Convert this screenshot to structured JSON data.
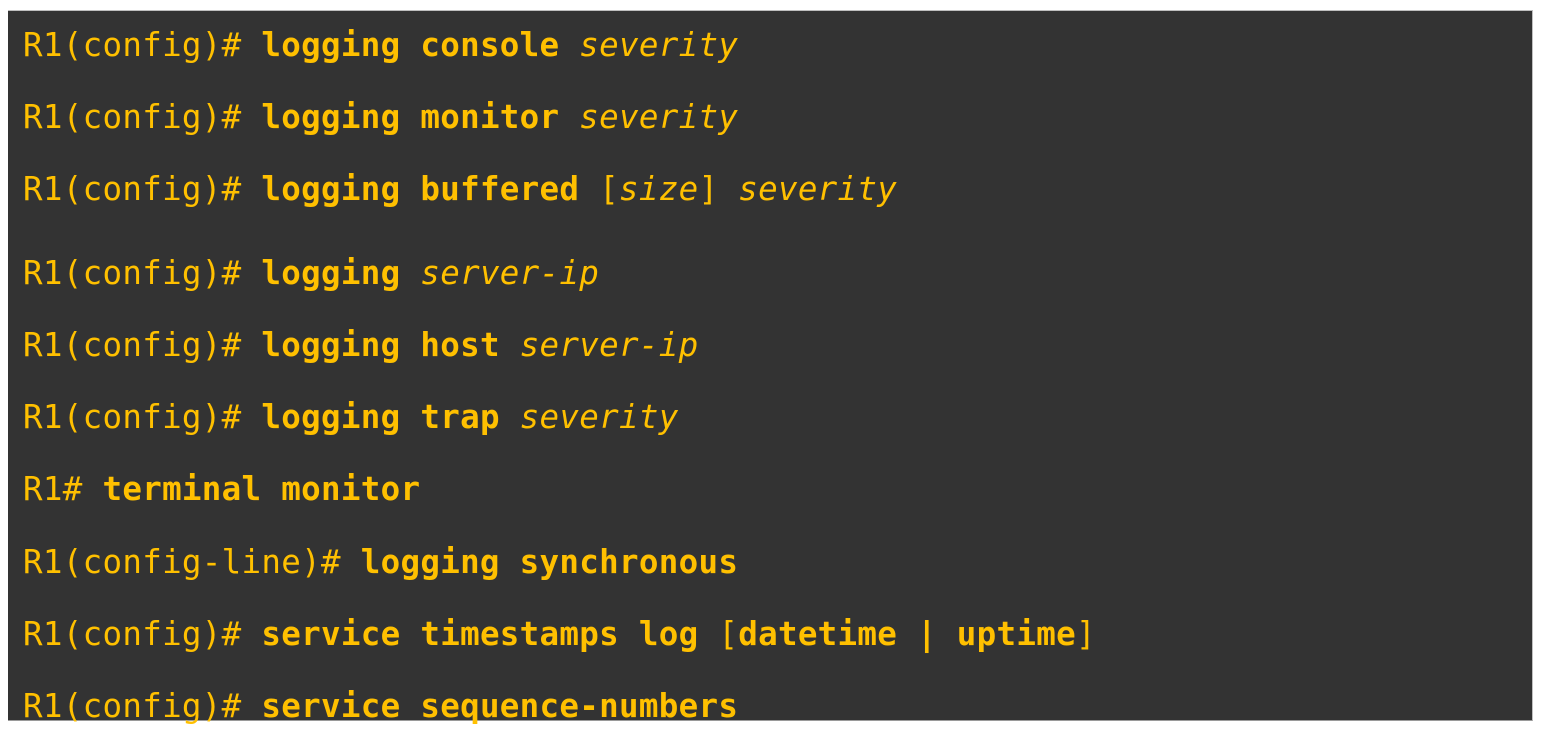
{
  "colors": {
    "background": "#333333",
    "text": "#FFC000"
  },
  "lines": [
    {
      "prompt": "R1(config)# ",
      "kw": "logging console ",
      "arg": "severity"
    },
    {
      "prompt": "R1(config)# ",
      "kw": "logging monitor ",
      "arg": "severity"
    },
    {
      "prompt": "R1(config)# ",
      "kw": "logging buffered ",
      "br1": "[",
      "arg1": "size",
      "br2": "] ",
      "arg": "severity"
    },
    {
      "prompt": "R1(config)# ",
      "kw": "logging ",
      "arg": "server-ip"
    },
    {
      "prompt": "R1(config)# ",
      "kw": "logging host ",
      "arg": "server-ip"
    },
    {
      "prompt": "R1(config)# ",
      "kw": "logging trap ",
      "arg": "severity"
    },
    {
      "prompt": "R1# ",
      "kw": "terminal monitor"
    },
    {
      "prompt": "R1(config-line)# ",
      "kw": "logging synchronous"
    },
    {
      "prompt": "R1(config)# ",
      "kw": "service timestamps log ",
      "br1": "[",
      "opt1": "datetime",
      "sep": " | ",
      "opt2": "uptime",
      "br2": "]"
    },
    {
      "prompt": "R1(config)# ",
      "kw": "service sequence-numbers"
    }
  ]
}
